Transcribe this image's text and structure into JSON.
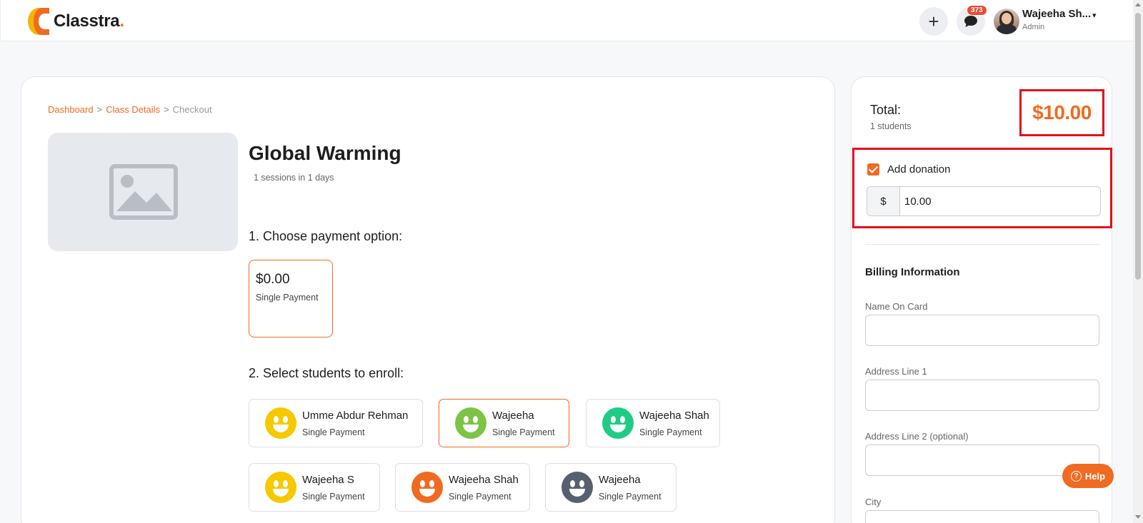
{
  "header": {
    "logo_text": "Classtra",
    "logo_dot": ".",
    "plus_icon": "+",
    "chat_badge": "373",
    "user_name": "Wajeeha Sh...",
    "user_role": "Admin",
    "caret": "▾"
  },
  "breadcrumb": {
    "items": [
      "Dashboard",
      "Class Details"
    ],
    "current": "Checkout",
    "separator": ">"
  },
  "class": {
    "title": "Global Warming",
    "subtitle": "1 sessions in 1 days"
  },
  "payment": {
    "section_title": "1. Choose payment option:",
    "options": [
      {
        "price": "$0.00",
        "type": "Single Payment"
      }
    ]
  },
  "students": {
    "section_title": "2. Select students to enroll:",
    "list": [
      {
        "name": "Umme Abdur Rehman",
        "type": "Single Payment",
        "color": "#f5c800",
        "selected": false
      },
      {
        "name": "Wajeeha",
        "type": "Single Payment",
        "color": "#7cc444",
        "selected": true
      },
      {
        "name": "Wajeeha Shah",
        "type": "Single Payment",
        "color": "#1ecc86",
        "selected": false
      },
      {
        "name": "Wajeeha S",
        "type": "Single Payment",
        "color": "#f5c800",
        "selected": false
      },
      {
        "name": "Wajeeha Shah",
        "type": "Single Payment",
        "color": "#f06a21",
        "selected": false
      },
      {
        "name": "Wajeeha",
        "type": "Single Payment",
        "color": "#56606e",
        "selected": false
      }
    ]
  },
  "summary": {
    "total_label": "Total:",
    "students_count": "1 students",
    "total_amount": "$10.00",
    "donation_label": "Add donation",
    "donation_checked": true,
    "donation_prefix": "$",
    "donation_value": "10.00",
    "billing_title": "Billing Information",
    "fields": [
      {
        "label": "Name On Card",
        "value": ""
      },
      {
        "label": "Address Line 1",
        "value": ""
      },
      {
        "label": "Address Line 2 (optional)",
        "value": ""
      },
      {
        "label": "City",
        "value": ""
      }
    ]
  },
  "help": {
    "label": "Help",
    "icon": "?"
  },
  "colors": {
    "accent": "#f06a21",
    "highlight_border": "#e3101b",
    "badge": "#e84b35"
  }
}
